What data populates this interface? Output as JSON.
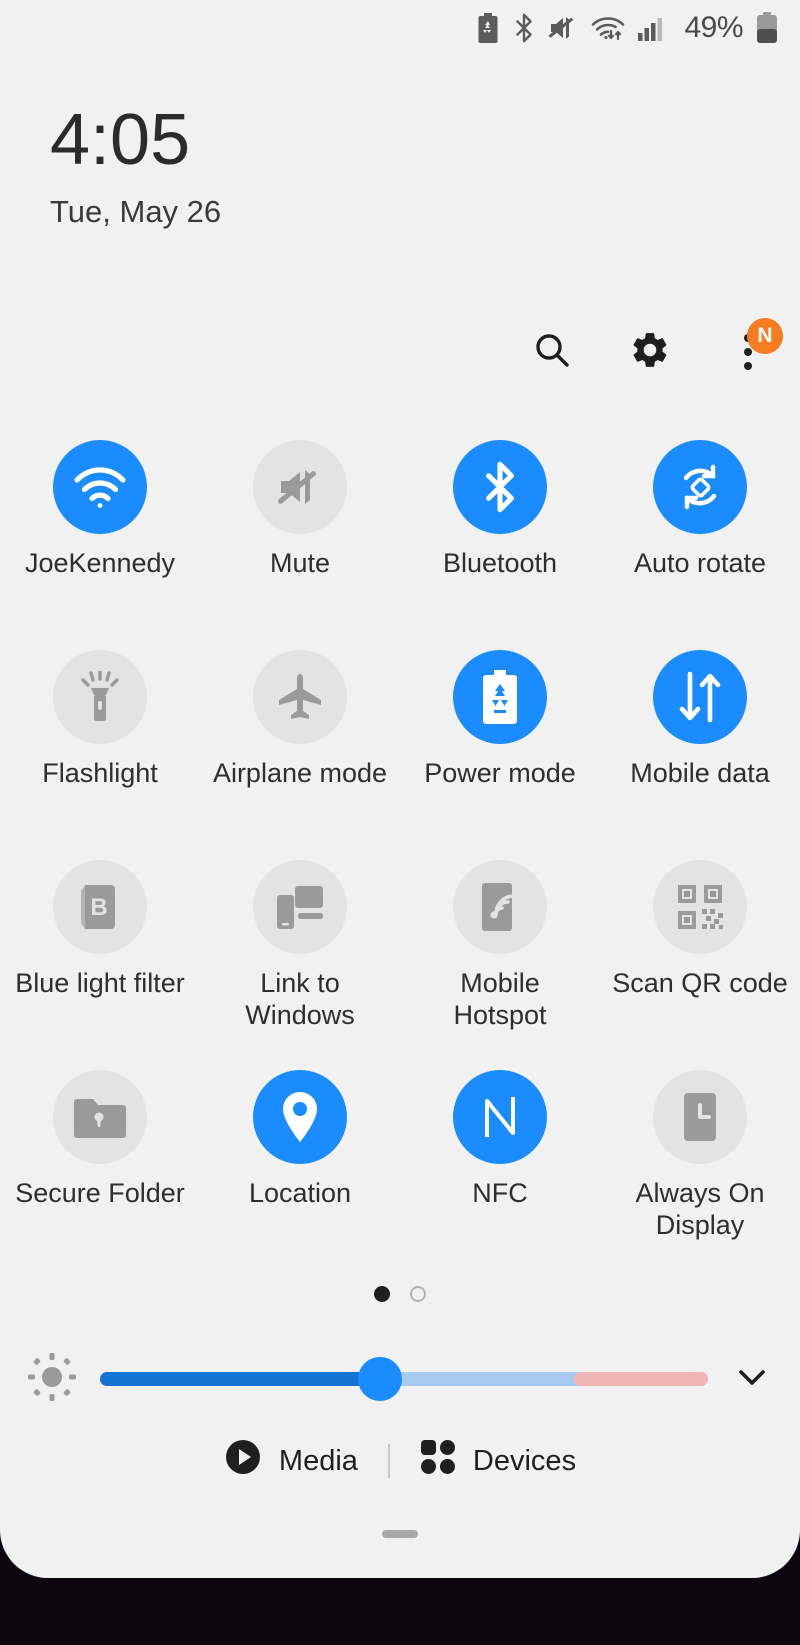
{
  "status_bar": {
    "icons": [
      "power-saving-battery-icon",
      "bluetooth-icon",
      "volume-mute-icon",
      "wifi-data-icon",
      "cell-signal-icon"
    ],
    "battery_percent": "49%"
  },
  "clock": {
    "time": "4:05",
    "date": "Tue, May 26"
  },
  "header": {
    "search_label": "Search",
    "settings_label": "Settings",
    "overflow_label": "More options",
    "notification_badge": "N"
  },
  "tiles": [
    {
      "label": "JoeKennedy",
      "icon": "wifi-icon",
      "state": "on"
    },
    {
      "label": "Mute",
      "icon": "volume-mute-icon",
      "state": "off"
    },
    {
      "label": "Bluetooth",
      "icon": "bluetooth-icon",
      "state": "on"
    },
    {
      "label": "Auto rotate",
      "icon": "auto-rotate-icon",
      "state": "on"
    },
    {
      "label": "Flashlight",
      "icon": "flashlight-icon",
      "state": "off"
    },
    {
      "label": "Airplane mode",
      "icon": "airplane-icon",
      "state": "off"
    },
    {
      "label": "Power mode",
      "icon": "power-mode-icon",
      "state": "on"
    },
    {
      "label": "Mobile data",
      "icon": "mobile-data-icon",
      "state": "on"
    },
    {
      "label": "Blue light filter",
      "icon": "blue-light-icon",
      "state": "off"
    },
    {
      "label": "Link to Windows",
      "icon": "link-to-windows-icon",
      "state": "off"
    },
    {
      "label": "Mobile Hotspot",
      "icon": "hotspot-icon",
      "state": "off"
    },
    {
      "label": "Scan QR code",
      "icon": "qr-code-icon",
      "state": "off"
    },
    {
      "label": "Secure Folder",
      "icon": "secure-folder-icon",
      "state": "off"
    },
    {
      "label": "Location",
      "icon": "location-pin-icon",
      "state": "on"
    },
    {
      "label": "NFC",
      "icon": "nfc-icon",
      "state": "on"
    },
    {
      "label": "Always On Display",
      "icon": "always-on-display-icon",
      "state": "off"
    }
  ],
  "pages": {
    "count": 2,
    "current": 1
  },
  "brightness": {
    "icon": "brightness-sun-icon",
    "value_percent": 46,
    "warm_start_percent": 78,
    "expand_label": "Expand"
  },
  "footer": {
    "media_label": "Media",
    "devices_label": "Devices"
  },
  "colors": {
    "accent": "#1a8cff",
    "tile_off": "#e3e3e3",
    "panel_bg": "#f1f1f1",
    "badge": "#f57c20",
    "slider_fill": "#1573d4",
    "slider_warm": "#f0b6b6"
  }
}
